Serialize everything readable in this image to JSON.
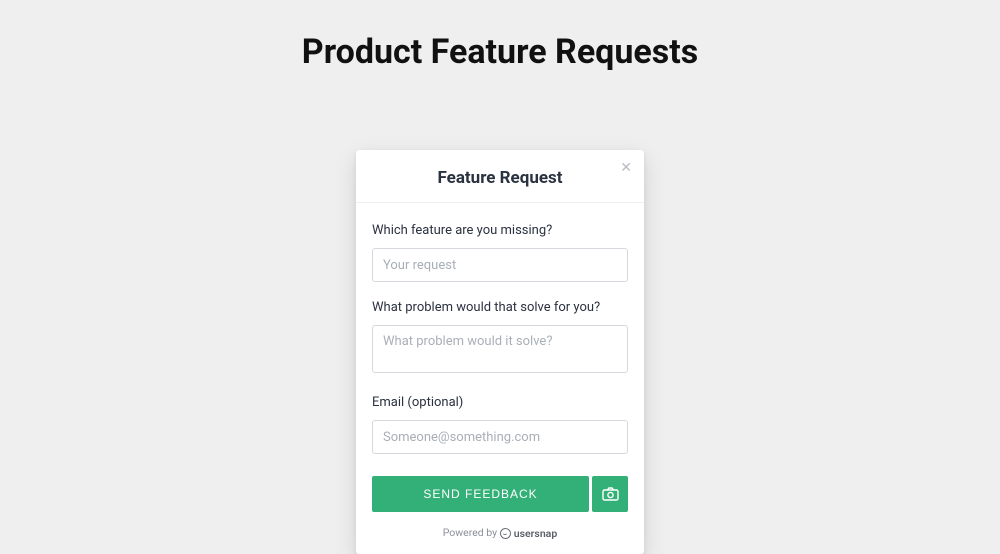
{
  "page": {
    "title": "Product Feature Requests"
  },
  "modal": {
    "title": "Feature Request",
    "fields": {
      "feature": {
        "label": "Which feature are you missing?",
        "placeholder": "Your request",
        "value": ""
      },
      "problem": {
        "label": "What problem would that solve for you?",
        "placeholder": "What problem would it solve?",
        "value": ""
      },
      "email": {
        "label": "Email (optional)",
        "placeholder": "Someone@something.com",
        "value": ""
      }
    },
    "actions": {
      "send_label": "SEND FEEDBACK"
    },
    "footer": {
      "powered_by": "Powered by",
      "brand": "usersnap"
    }
  }
}
